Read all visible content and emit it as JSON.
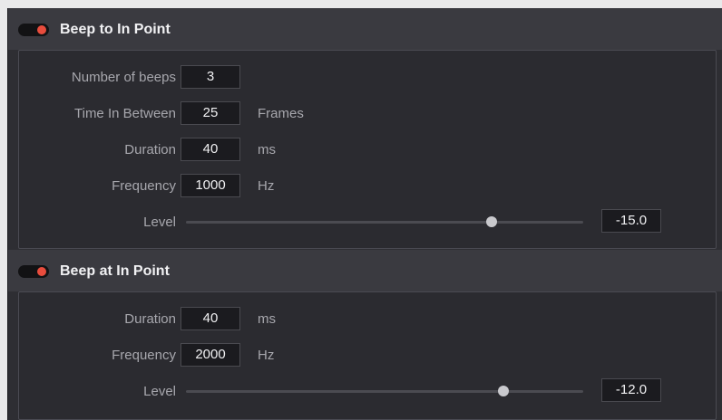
{
  "sections": [
    {
      "title": "Beep to In Point",
      "enabled": true,
      "number_of_beeps": {
        "label": "Number of beeps",
        "value": "3"
      },
      "time_in_between": {
        "label": "Time In Between",
        "value": "25",
        "unit": "Frames"
      },
      "duration": {
        "label": "Duration",
        "value": "40",
        "unit": "ms"
      },
      "frequency": {
        "label": "Frequency",
        "value": "1000",
        "unit": "Hz"
      },
      "level": {
        "label": "Level",
        "value": "-15.0",
        "slider_fraction": 0.77
      }
    },
    {
      "title": "Beep at In Point",
      "enabled": true,
      "duration": {
        "label": "Duration",
        "value": "40",
        "unit": "ms"
      },
      "frequency": {
        "label": "Frequency",
        "value": "2000",
        "unit": "Hz"
      },
      "level": {
        "label": "Level",
        "value": "-12.0",
        "slider_fraction": 0.8
      }
    }
  ],
  "colors": {
    "toggle_on": "#e84c3d",
    "panel_bg": "#2e2e33",
    "header_bg": "#3a3a40"
  }
}
